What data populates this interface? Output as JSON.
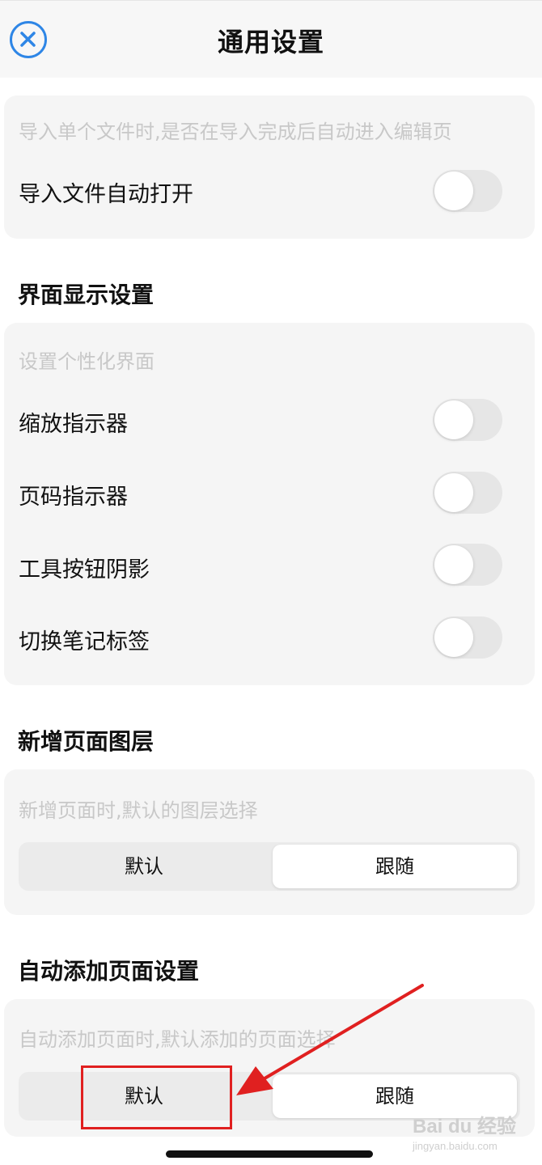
{
  "header": {
    "title": "通用设置",
    "close_icon": "close-circle-icon",
    "accent": "#2e86e6"
  },
  "import_section": {
    "hint": "导入单个文件时,是否在导入完成后自动进入编辑页",
    "toggle_label": "导入文件自动打开",
    "toggle_on": false
  },
  "display_section": {
    "title": "界面显示设置",
    "hint": "设置个性化界面",
    "items": [
      {
        "label": "缩放指示器",
        "on": false
      },
      {
        "label": "页码指示器",
        "on": false
      },
      {
        "label": "工具按钮阴影",
        "on": false
      },
      {
        "label": "切换笔记标签",
        "on": false
      }
    ]
  },
  "layer_section": {
    "title": "新增页面图层",
    "hint": "新增页面时,默认的图层选择",
    "options": [
      "默认",
      "跟随"
    ],
    "selected": "跟随"
  },
  "auto_page_section": {
    "title": "自动添加页面设置",
    "hint": "自动添加页面时,默认添加的页面选择",
    "options": [
      "默认",
      "跟随"
    ],
    "selected": "跟随"
  },
  "annotation": {
    "color": "#e02020"
  },
  "watermark": {
    "main": "Bai du 经验",
    "sub": "jingyan.baidu.com"
  }
}
